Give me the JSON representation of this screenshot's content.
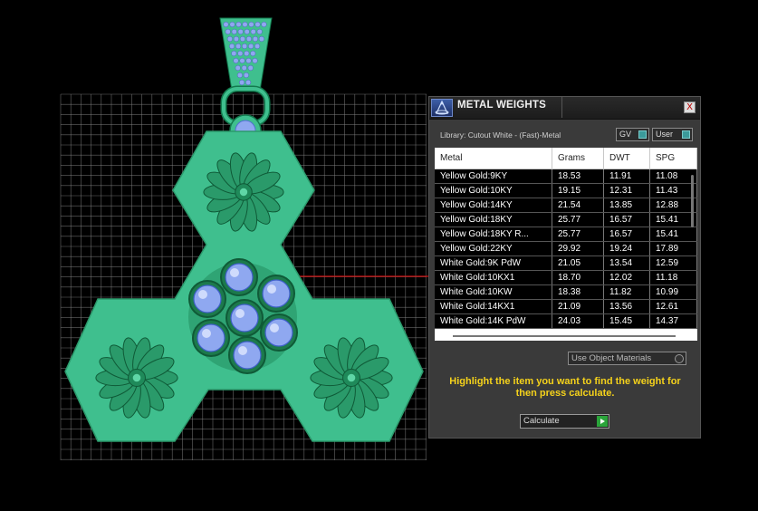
{
  "panel": {
    "title": "METAL WEIGHTS",
    "close_glyph": "X",
    "library_label": "Library: Cutout White - (Fast)-Metal",
    "gv_toggle": "GV",
    "user_toggle": "User",
    "columns": [
      "Metal",
      "Grams",
      "DWT",
      "SPG"
    ],
    "rows": [
      [
        "Yellow Gold:9KY",
        "18.53",
        "11.91",
        "11.08"
      ],
      [
        "Yellow Gold:10KY",
        "19.15",
        "12.31",
        "11.43"
      ],
      [
        "Yellow Gold:14KY",
        "21.54",
        "13.85",
        "12.88"
      ],
      [
        "Yellow Gold:18KY",
        "25.77",
        "16.57",
        "15.41"
      ],
      [
        "Yellow Gold:18KY R...",
        "25.77",
        "16.57",
        "15.41"
      ],
      [
        "Yellow Gold:22KY",
        "29.92",
        "19.24",
        "17.89"
      ],
      [
        "White Gold:9K PdW",
        "21.05",
        "13.54",
        "12.59"
      ],
      [
        "White Gold:10KX1",
        "18.70",
        "12.02",
        "11.18"
      ],
      [
        "White Gold:10KW",
        "18.38",
        "11.82",
        "10.99"
      ],
      [
        "White Gold:14KX1",
        "21.09",
        "13.56",
        "12.61"
      ],
      [
        "White Gold:14K PdW",
        "24.03",
        "15.45",
        "14.37"
      ]
    ],
    "object_materials": "Use Object Materials",
    "instructions": "Highlight the item you want to find the weight for then press calculate.",
    "calculate": "Calculate"
  },
  "colors": {
    "background": "#000000",
    "grid": "#8a8a8a",
    "metal_green": "#3fbf8e",
    "gem_blue": "#8fa8f0",
    "accent_yellow": "#f5d21b",
    "axis_red": "#cc1111"
  },
  "icons": {
    "panel_logo": "metal-weights-logo-icon",
    "close": "close-icon",
    "calculate_go": "play-icon"
  }
}
